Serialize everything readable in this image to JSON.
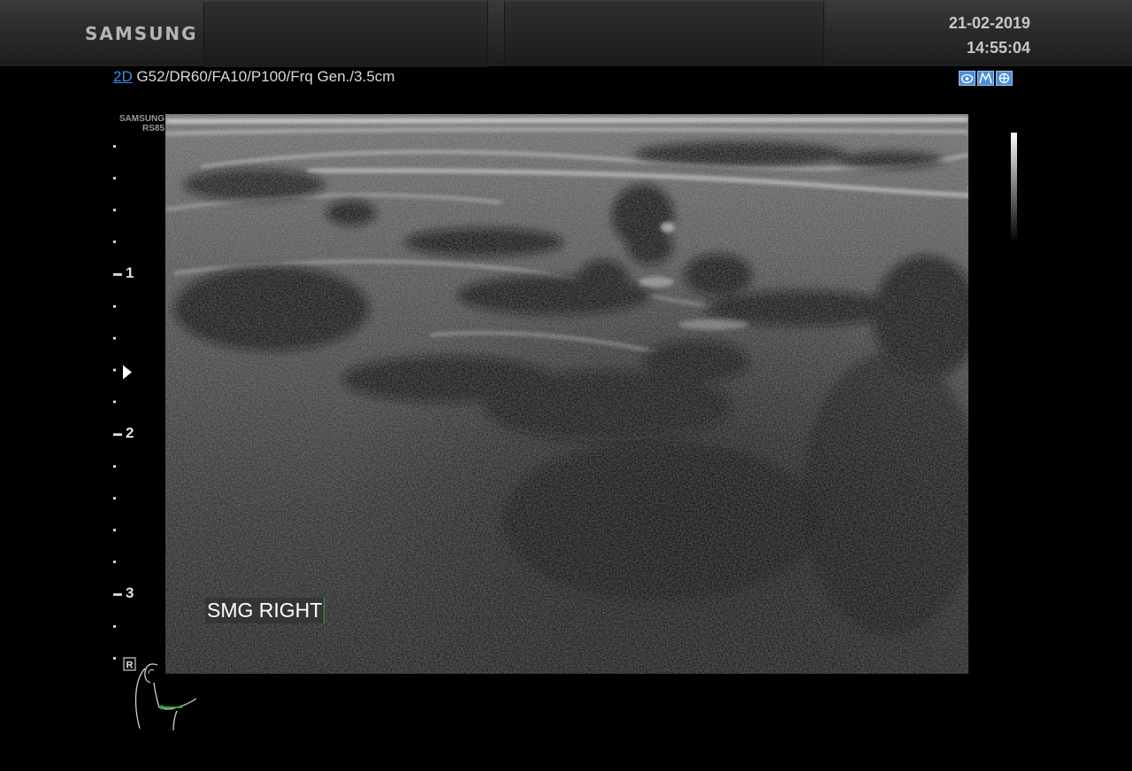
{
  "header": {
    "brand": "SAMSUNG",
    "date": "21-02-2019",
    "time": "14:55:04"
  },
  "params": {
    "mode": "2D",
    "settings": " G52/DR60/FA10/P100/Frq Gen./3.5cm"
  },
  "toolbar_icons": [
    "probe-icon",
    "map-icon",
    "target-icon"
  ],
  "probe": {
    "brand": "SAMSUNG",
    "model": "RS85"
  },
  "depth_scale": {
    "labels": [
      "1",
      "2",
      "3"
    ],
    "unit": "cm"
  },
  "annotation": {
    "text": "SMG RIGHT"
  },
  "body_marker": {
    "side_label": "R"
  },
  "colors": {
    "mode_accent": "#3c8ce8",
    "marker_green": "#2ea43a",
    "icon_blue": "#4a8fd6"
  }
}
